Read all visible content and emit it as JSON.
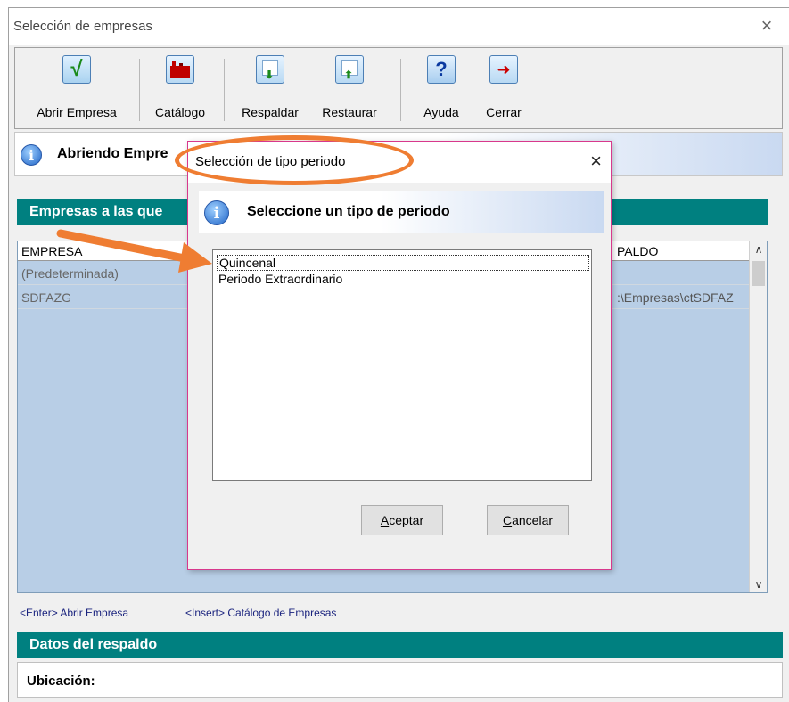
{
  "window": {
    "title": "Selección de empresas",
    "close_glyph": "×"
  },
  "toolbar": {
    "buttons": [
      {
        "label": "Abrir Empresa",
        "icon": "check-icon"
      },
      {
        "label": "Catálogo",
        "icon": "factory-icon"
      },
      {
        "label": "Respaldar",
        "icon": "backup-disk-icon"
      },
      {
        "label": "Restaurar",
        "icon": "restore-disk-icon"
      },
      {
        "label": "Ayuda",
        "icon": "help-icon"
      },
      {
        "label": "Cerrar",
        "icon": "exit-door-icon"
      }
    ]
  },
  "info": {
    "text": "Abriendo Empre"
  },
  "companies_section": {
    "title": "Empresas a las que"
  },
  "grid": {
    "columns": [
      "EMPRESA",
      "PALDO"
    ],
    "rows": [
      {
        "empresa": "(Predeterminada)",
        "respaldo": ""
      },
      {
        "empresa": "SDFAZG",
        "respaldo": ":\\Empresas\\ctSDFAZ"
      }
    ]
  },
  "hints": {
    "open": "<Enter> Abrir Empresa",
    "catalog": "<Insert> Catálogo de Empresas"
  },
  "backup_section": {
    "title": "Datos del respaldo",
    "location_label": "Ubicación:"
  },
  "dialog": {
    "title": "Selección de tipo periodo",
    "close_glyph": "×",
    "prompt": "Seleccione un tipo de periodo",
    "options": [
      "Quincenal",
      "Periodo Extraordinario"
    ],
    "selected": "Quincenal",
    "accept_label": "Aceptar",
    "cancel_label": "Cancelar"
  },
  "annotation_color": "#ef7d32"
}
